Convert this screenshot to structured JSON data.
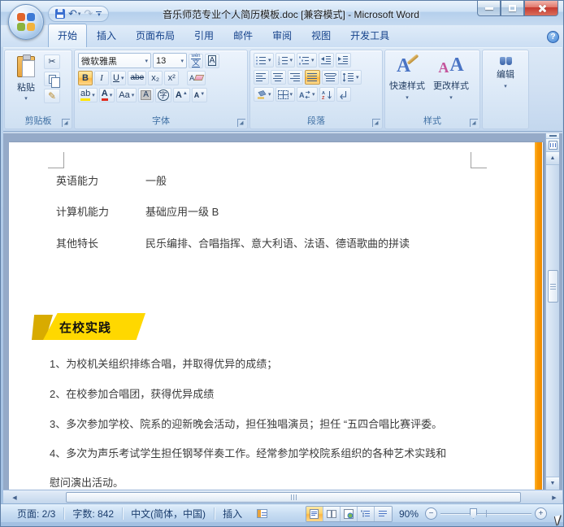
{
  "window": {
    "title": "音乐师范专业个人简历模板.doc [兼容模式] - Microsoft Word"
  },
  "tabs": [
    "开始",
    "插入",
    "页面布局",
    "引用",
    "邮件",
    "审阅",
    "视图",
    "开发工具"
  ],
  "glyphs": {
    "dd": "▾",
    "help": "?",
    "undo": "↶",
    "redo": "↷",
    "scissors": "✂",
    "painter": "✎",
    "up": "▲",
    "down": "▼",
    "left": "◀",
    "right": "▶",
    "minus": "−",
    "plus": "+"
  },
  "ribbon": {
    "clipboard": {
      "label": "剪贴板",
      "paste": "粘贴"
    },
    "font": {
      "label": "字体",
      "name": "微软雅黑",
      "size": "13",
      "bold": "B",
      "italic": "I",
      "underline": "U",
      "strike": "abe",
      "subscript": "x₂",
      "superscript": "x²",
      "clear": "A",
      "phonetic_top": "wén",
      "phonetic_bottom": "文",
      "char_border": "A",
      "highlight": "ab",
      "color": "A",
      "case": "Aa",
      "char_shade": "A",
      "enclose": "字",
      "grow": "A",
      "shrink": "A"
    },
    "paragraph": {
      "label": "段落"
    },
    "styles": {
      "label": "样式",
      "quick": "快速样式",
      "change": "更改样式"
    },
    "editing": {
      "label": "编辑"
    }
  },
  "document": {
    "skills": [
      {
        "label": "英语能力",
        "value": "一般"
      },
      {
        "label": "计算机能力",
        "value": "基础应用一级 B"
      },
      {
        "label": "其他特长",
        "value": "民乐编排、合唱指挥、意大利语、法语、德语歌曲的拼读"
      }
    ],
    "section_title": "在校实践",
    "items": [
      "1、为校机关组织排练合唱，并取得优异的成绩；",
      "2、在校参加合唱团，获得优异成绩",
      "3、多次参加学校、院系的迎新晚会活动，担任独唱演员；担任 “五四合唱比赛评委。",
      "4、多次为声乐考试学生担任钢琴伴奏工作。经常参加学校院系组织的各种艺术实践和",
      "慰问演出活动。"
    ]
  },
  "status": {
    "page": "页面: 2/3",
    "words": "字数: 842",
    "language": "中文(简体，中国)",
    "mode": "插入",
    "zoom": "90%"
  },
  "colors": {
    "highlight_orange": "#fcb643",
    "banner_yellow": "#ffd800",
    "page_stripe_orange": "#f79500",
    "close_red": "#c6392f"
  }
}
